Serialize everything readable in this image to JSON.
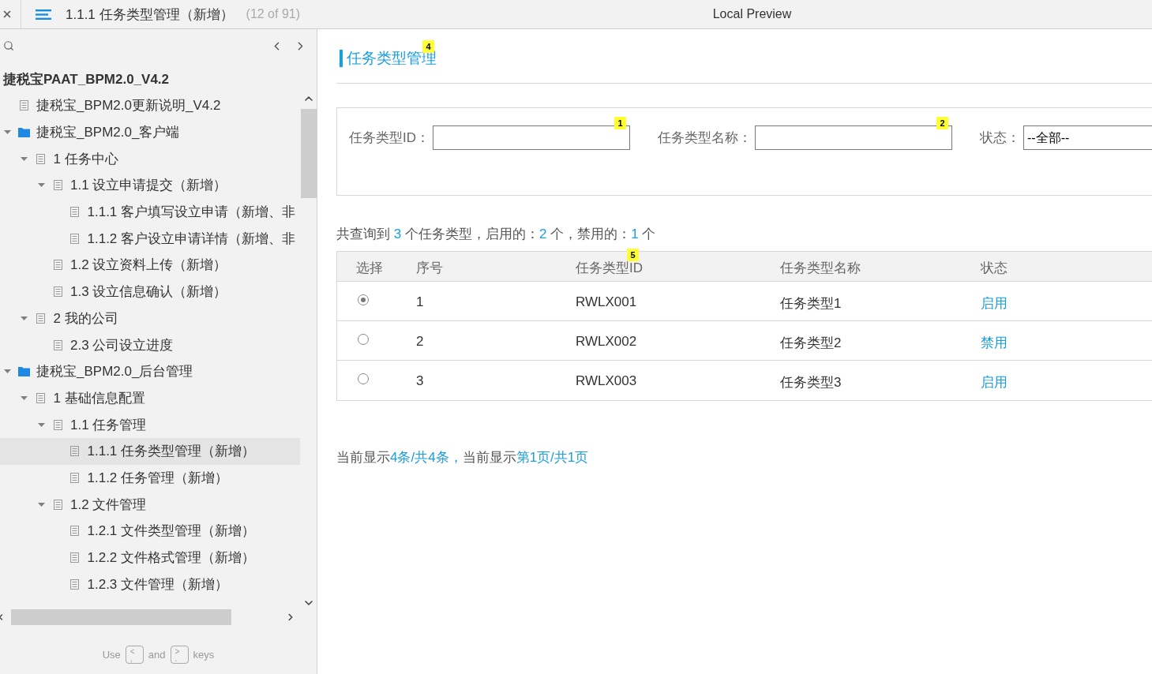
{
  "top_bar": {
    "page_title": "1.1.1 任务类型管理（新增）",
    "page_count": "(12 of 91)",
    "preview_title": "Local Preview"
  },
  "sidebar": {
    "project_title": "捷税宝PAAT_BPM2.0_V4.2",
    "tree": [
      {
        "label": "捷税宝_BPM2.0更新说明_V4.2",
        "kind": "page",
        "selected": false
      },
      {
        "label": "捷税宝_BPM2.0_客户端",
        "kind": "folder",
        "expanded": true,
        "selected": false,
        "children": [
          {
            "label": "1 任务中心",
            "kind": "page",
            "expanded": true,
            "selected": false,
            "children": [
              {
                "label": "1.1 设立申请提交（新增）",
                "kind": "page",
                "expanded": true,
                "selected": false,
                "children": [
                  {
                    "label": "1.1.1 客户填写设立申请（新增、非",
                    "kind": "page",
                    "selected": false
                  },
                  {
                    "label": "1.1.2 客户设立申请详情（新增、非",
                    "kind": "page",
                    "selected": false
                  }
                ]
              },
              {
                "label": "1.2 设立资料上传（新增）",
                "kind": "page",
                "selected": false
              },
              {
                "label": "1.3 设立信息确认（新增）",
                "kind": "page",
                "selected": false
              }
            ]
          },
          {
            "label": "2 我的公司",
            "kind": "page",
            "expanded": true,
            "selected": false,
            "children": [
              {
                "label": "2.3 公司设立进度",
                "kind": "page",
                "selected": false
              }
            ]
          }
        ]
      },
      {
        "label": "捷税宝_BPM2.0_后台管理",
        "kind": "folder",
        "expanded": true,
        "selected": false,
        "children": [
          {
            "label": "1 基础信息配置",
            "kind": "page",
            "expanded": true,
            "selected": false,
            "children": [
              {
                "label": "1.1 任务管理",
                "kind": "page",
                "expanded": true,
                "selected": false,
                "children": [
                  {
                    "label": "1.1.1 任务类型管理（新增）",
                    "kind": "page",
                    "selected": true
                  },
                  {
                    "label": "1.1.2 任务管理（新增）",
                    "kind": "page",
                    "selected": false
                  }
                ]
              },
              {
                "label": "1.2 文件管理",
                "kind": "page",
                "expanded": true,
                "selected": false,
                "children": [
                  {
                    "label": "1.2.1 文件类型管理（新增）",
                    "kind": "page",
                    "selected": false
                  },
                  {
                    "label": "1.2.2 文件格式管理（新增）",
                    "kind": "page",
                    "selected": false
                  },
                  {
                    "label": "1.2.3 文件管理（新增）",
                    "kind": "page",
                    "selected": false
                  }
                ]
              }
            ]
          }
        ]
      }
    ],
    "help": [
      {
        "kind": "word",
        "text": "Use"
      },
      {
        "kind": "key",
        "top": "<",
        "bottom": ","
      },
      {
        "kind": "word",
        "text": "and"
      },
      {
        "kind": "key",
        "top": ">",
        "bottom": "."
      },
      {
        "kind": "word",
        "text": "keys"
      }
    ]
  },
  "content": {
    "title": {
      "text": "任务类型管理",
      "footnote": "4"
    },
    "filters": [
      {
        "kind": "text",
        "label": "任务类型ID：",
        "footnote": "1"
      },
      {
        "kind": "text",
        "label": "任务类型名称：",
        "footnote": "2"
      },
      {
        "kind": "select",
        "label": "状态：",
        "value": "--全部--"
      }
    ],
    "summary": [
      {
        "kind": "plain",
        "text": "共查询到 "
      },
      {
        "kind": "count",
        "text": "3"
      },
      {
        "kind": "plain",
        "text": " 个任务类型，启用的："
      },
      {
        "kind": "count",
        "text": "2"
      },
      {
        "kind": "plain",
        "text": " 个，禁用的："
      },
      {
        "kind": "count",
        "text": "1"
      },
      {
        "kind": "plain",
        "text": " 个"
      }
    ],
    "table": {
      "columns": [
        {
          "label": "选择"
        },
        {
          "label": "序号"
        },
        {
          "label": "任务类型ID",
          "footnote": "5"
        },
        {
          "label": "任务类型名称"
        },
        {
          "label": "状态"
        }
      ],
      "rows": [
        {
          "selected": true,
          "number": "1",
          "id": "RWLX001",
          "name": "任务类型1",
          "status": "启用"
        },
        {
          "selected": false,
          "number": "2",
          "id": "RWLX002",
          "name": "任务类型2",
          "status": "禁用"
        },
        {
          "selected": false,
          "number": "3",
          "id": "RWLX003",
          "name": "任务类型3",
          "status": "启用"
        }
      ]
    },
    "pagination": [
      {
        "kind": "plain",
        "text": "当前显示"
      },
      {
        "kind": "link",
        "text": "4条/共4条，"
      },
      {
        "kind": "plain",
        "text": "当前显示"
      },
      {
        "kind": "link",
        "text": "第1页/共1页"
      }
    ]
  }
}
